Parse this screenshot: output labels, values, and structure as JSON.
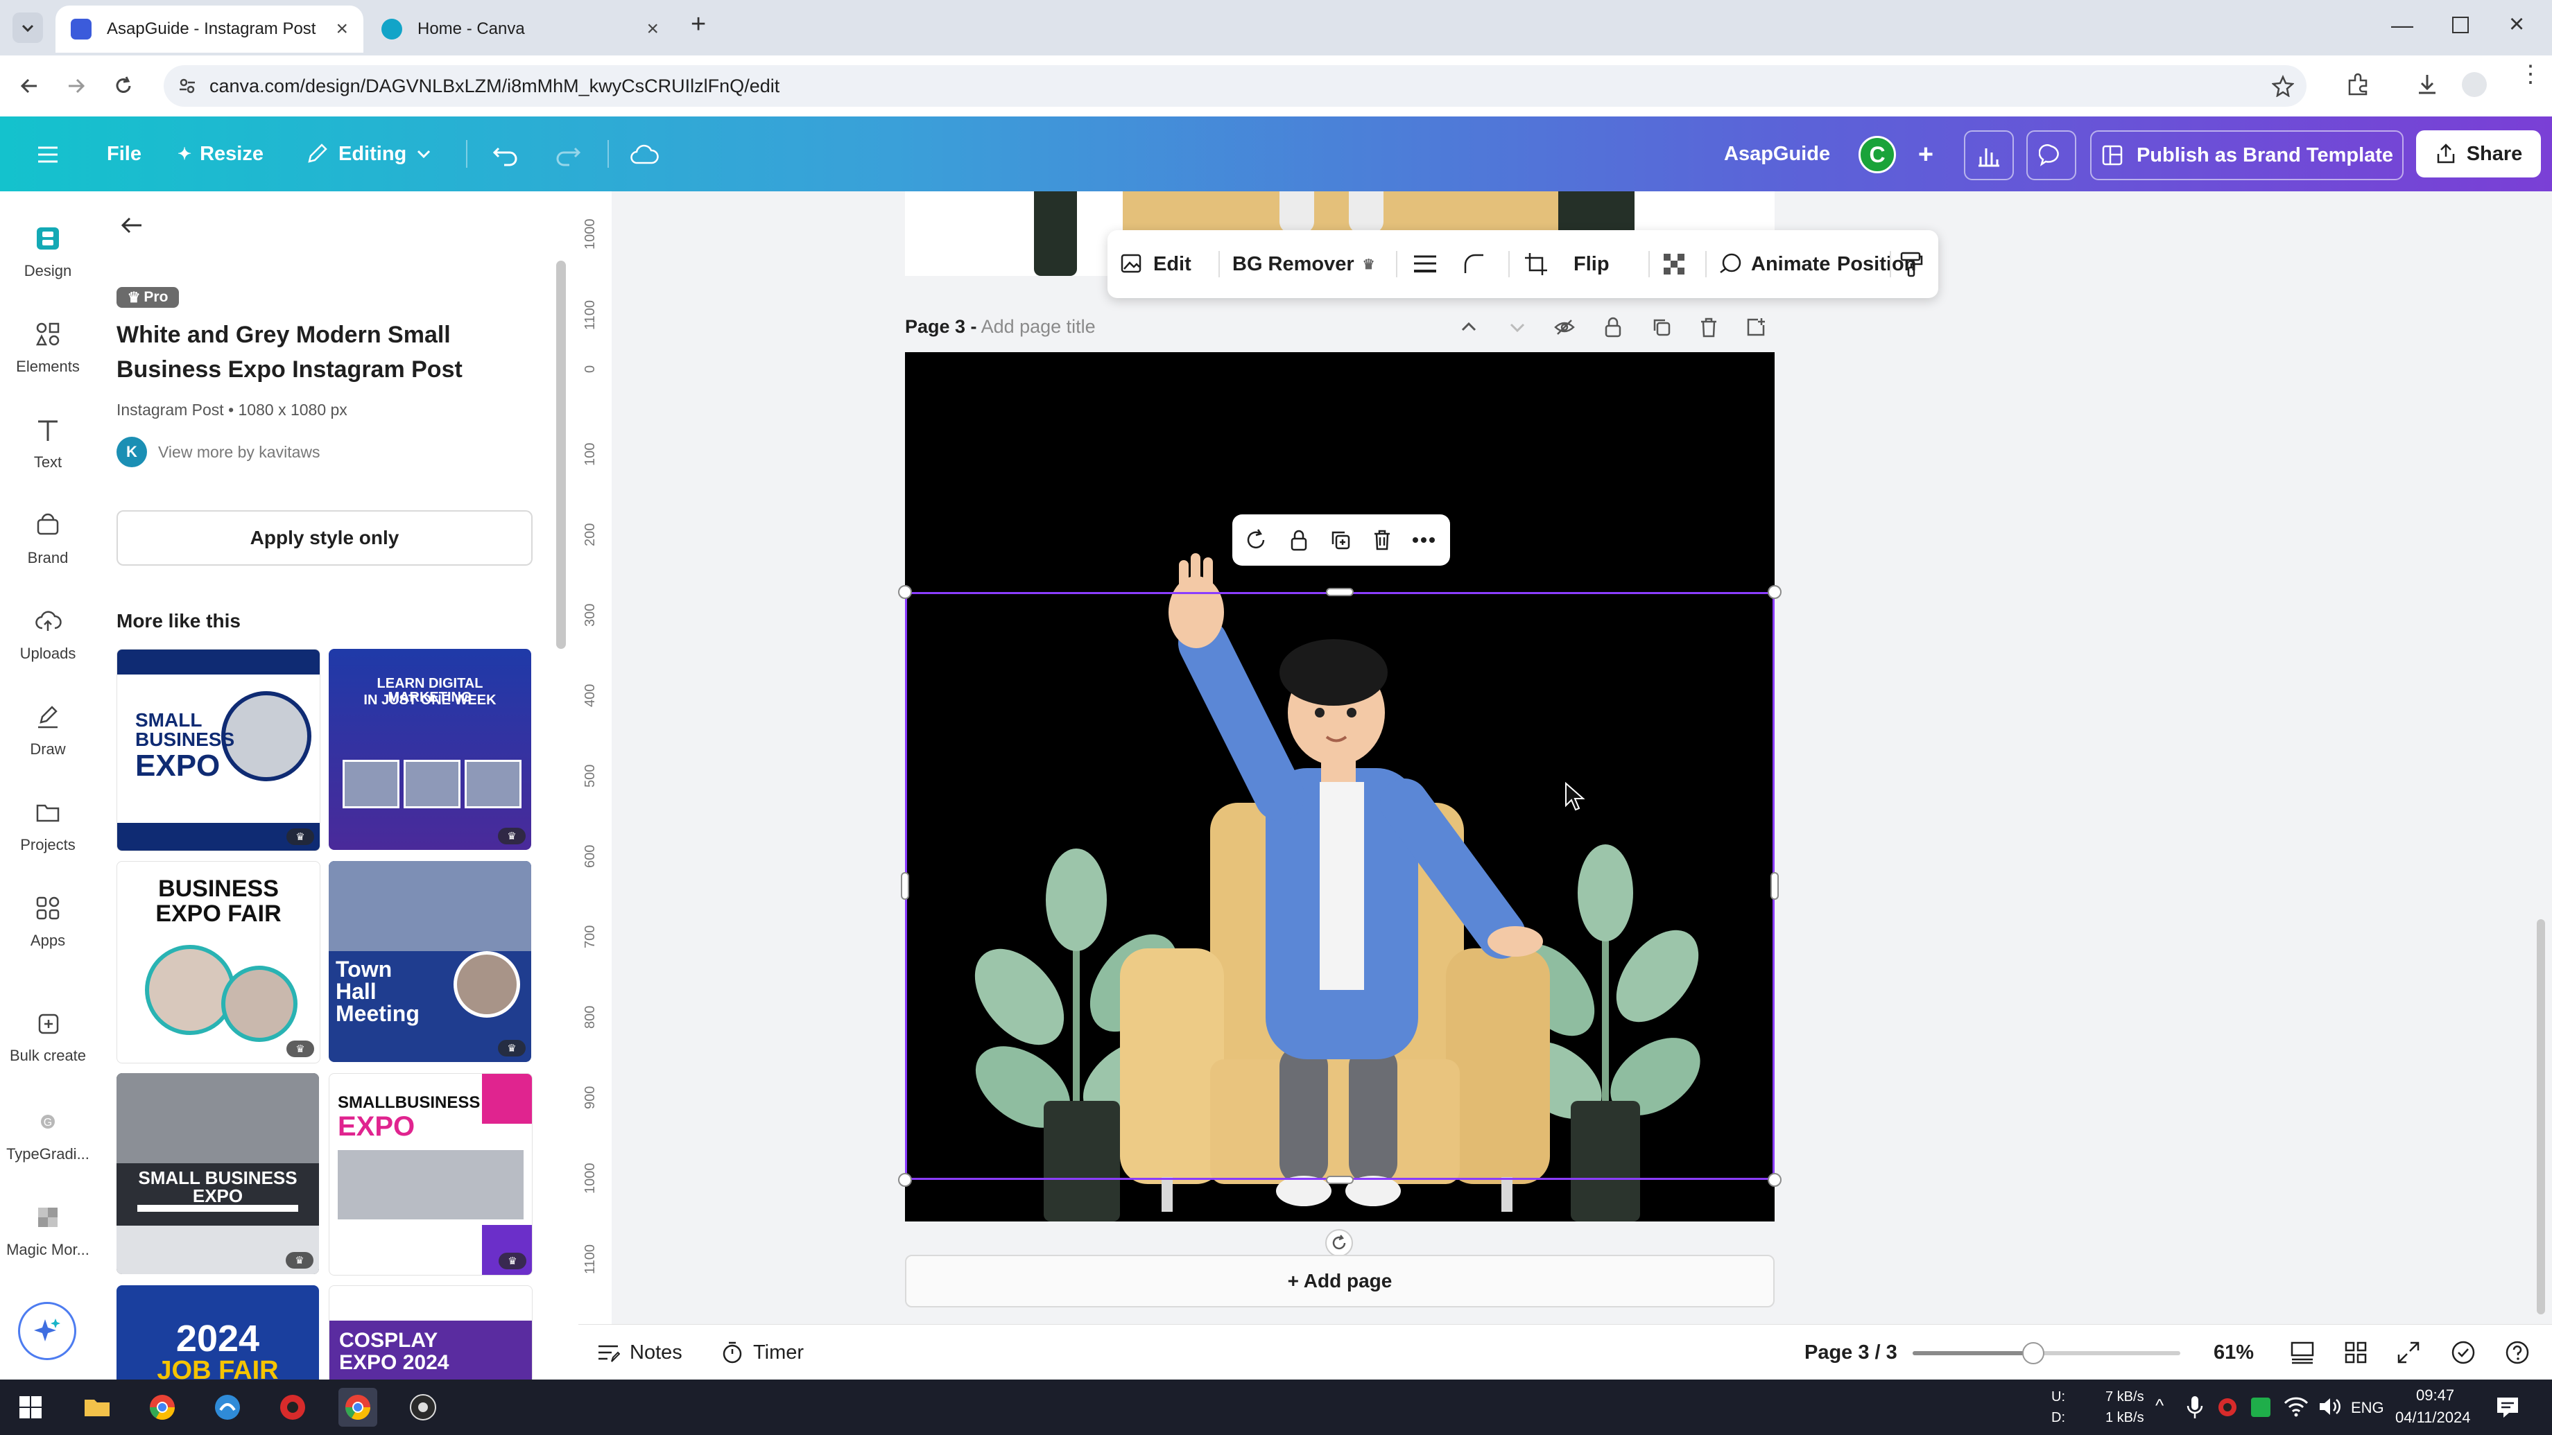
{
  "browser": {
    "tabs": [
      {
        "title": "AsapGuide - Instagram Post",
        "active": true
      },
      {
        "title": "Home - Canva",
        "active": false
      }
    ],
    "url": "canva.com/design/DAGVNLBxLZM/i8mMhM_kwyCsCRUIlzlFnQ/edit"
  },
  "header": {
    "file_label": "File",
    "resize_label": "Resize",
    "editing_label": "Editing",
    "team_name": "AsapGuide",
    "avatar_letter": "C",
    "publish_label": "Publish as Brand Template",
    "share_label": "Share"
  },
  "rail": {
    "items": [
      {
        "label": "Design",
        "icon": "design-icon"
      },
      {
        "label": "Elements",
        "icon": "elements-icon"
      },
      {
        "label": "Text",
        "icon": "text-icon"
      },
      {
        "label": "Brand",
        "icon": "brand-icon"
      },
      {
        "label": "Uploads",
        "icon": "uploads-icon"
      },
      {
        "label": "Draw",
        "icon": "draw-icon"
      },
      {
        "label": "Projects",
        "icon": "projects-icon"
      },
      {
        "label": "Apps",
        "icon": "apps-icon"
      },
      {
        "label": "Bulk create",
        "icon": "bulk-create-icon"
      },
      {
        "label": "TypeGradi...",
        "icon": "typegradient-icon"
      },
      {
        "label": "Magic Mor...",
        "icon": "magic-morph-icon"
      }
    ]
  },
  "panel": {
    "badge": "Pro",
    "title": "White and Grey Modern Small Business Expo Instagram Post",
    "meta": "Instagram Post • 1080 x 1080 px",
    "author_initial": "K",
    "author_text": "View more by kavitaws",
    "apply_label": "Apply style only",
    "more_heading": "More like this",
    "thumbnails": [
      {
        "lines": [
          "SMALL",
          "BUSINESS",
          "EXPO"
        ]
      },
      {
        "lines": [
          "LEARN DIGITAL MARKETING",
          "IN JUST ONE WEEK"
        ]
      },
      {
        "lines": [
          "BUSINESS",
          "EXPO FAIR"
        ]
      },
      {
        "lines": [
          "Town",
          "Hall",
          "Meeting"
        ]
      },
      {
        "lines": [
          "SMALL BUSINESS EXPO"
        ]
      },
      {
        "lines": [
          "SMALLBUSINESS",
          "EXPO"
        ]
      },
      {
        "lines": [
          "2024",
          "JOB FAIR"
        ]
      },
      {
        "lines": [
          "COSPLAY",
          "EXPO 2024"
        ]
      }
    ]
  },
  "ruler": [
    "1000",
    "1100",
    "0",
    "100",
    "200",
    "300",
    "400",
    "500",
    "600",
    "700",
    "800",
    "900",
    "1000",
    "1100"
  ],
  "canvas": {
    "context_toolbar": {
      "edit_label": "Edit",
      "bg_remover_label": "BG Remover",
      "flip_label": "Flip",
      "animate_label": "Animate",
      "position_label": "Position"
    },
    "page_label": "Page 3 -",
    "page_title_placeholder": "Add page title",
    "add_page_label": "+ Add page"
  },
  "footer": {
    "notes_label": "Notes",
    "timer_label": "Timer",
    "page_counter": "Page 3 / 3",
    "zoom_label": "61%",
    "zoom_fraction": 0.45
  },
  "taskbar": {
    "net_up_label": "U:",
    "net_down_label": "D:",
    "net_up": "7 kB/s",
    "net_down": "1 kB/s",
    "language": "ENG",
    "time": "09:47",
    "date": "04/11/2024"
  },
  "colors": {
    "selection": "#8b3dff",
    "avatar": "#1aa33a",
    "header_start": "#14c2cd",
    "header_end": "#7a3fd6"
  }
}
